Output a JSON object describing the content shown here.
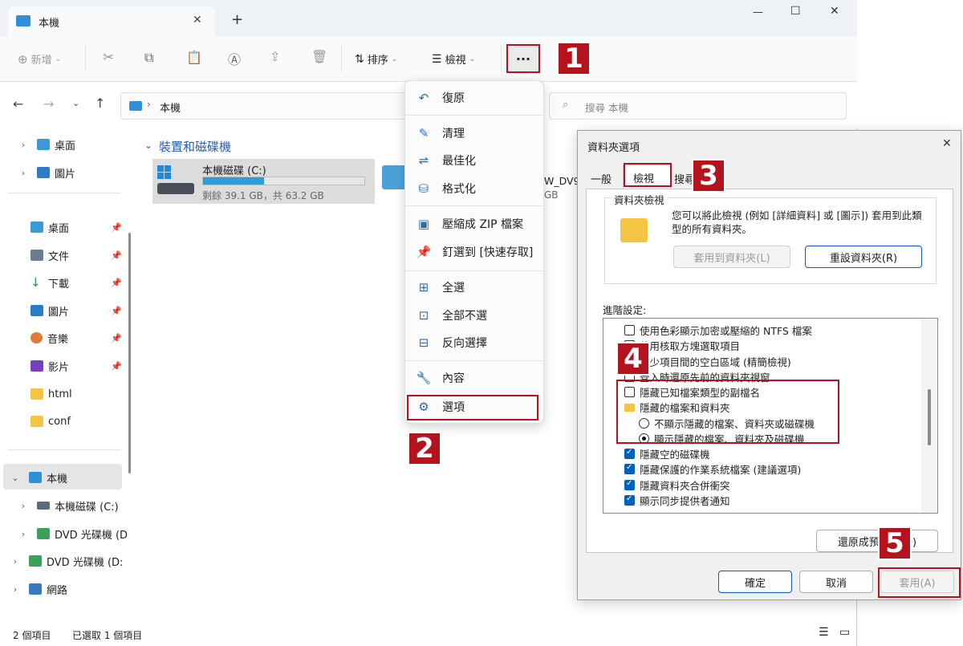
{
  "tab": {
    "title": "本機",
    "new_tab": "+"
  },
  "window_controls": {
    "minimize": "—",
    "maximize": "☐",
    "close": "✕"
  },
  "toolbar": {
    "new": "新增",
    "sort": "排序",
    "view": "檢視",
    "more": "···"
  },
  "address": {
    "location": "本機",
    "search_placeholder": "搜尋 本機"
  },
  "sidebar": {
    "top": [
      {
        "label": "桌面"
      },
      {
        "label": "圖片"
      }
    ],
    "pinned": [
      {
        "label": "桌面"
      },
      {
        "label": "文件"
      },
      {
        "label": "下載"
      },
      {
        "label": "圖片"
      },
      {
        "label": "音樂"
      },
      {
        "label": "影片"
      },
      {
        "label": "html"
      },
      {
        "label": "conf"
      }
    ],
    "this_pc": "本機",
    "this_pc_children": [
      {
        "label": "本機磁碟 (C:)"
      },
      {
        "label": "DVD 光碟機 (D"
      }
    ],
    "dvd": "DVD 光碟機 (D:",
    "network": "網路"
  },
  "content": {
    "group_title": "裝置和磁碟機",
    "drive_c": {
      "name": "本機磁碟 (C:)",
      "info": "剩餘 39.1 GB，共 63.2 GB",
      "used_fraction": 0.38
    },
    "dvd_partial_name": "W_DV9",
    "dvd_partial_info": "GB"
  },
  "status": {
    "count": "2 個項目",
    "selected": "已選取 1 個項目"
  },
  "menu": {
    "items": [
      {
        "label": "復原"
      },
      {
        "label": "清理"
      },
      {
        "label": "最佳化"
      },
      {
        "label": "格式化"
      },
      {
        "label": "壓縮成 ZIP 檔案"
      },
      {
        "label": "釘選到 [快速存取]"
      },
      {
        "label": "全選"
      },
      {
        "label": "全部不選"
      },
      {
        "label": "反向選擇"
      },
      {
        "label": "內容"
      },
      {
        "label": "選項"
      }
    ]
  },
  "dialog": {
    "title": "資料夾選項",
    "close": "✕",
    "tabs": [
      "一般",
      "檢視",
      "搜尋"
    ],
    "folder_views": {
      "group": "資料夾檢視",
      "desc": "您可以將此檢視 (例如 [詳細資料] 或 [圖示]) 套用到此類型的所有資料夾。",
      "apply_btn": "套用到資料夾(L)",
      "reset_btn": "重設資料夾(R)"
    },
    "advanced_label": "進階設定:",
    "tree": [
      {
        "label": "使用色彩顯示加密或壓縮的 NTFS 檔案",
        "kind": "check",
        "on": false
      },
      {
        "label": "使用核取方塊選取項目",
        "kind": "check",
        "on": false
      },
      {
        "label": "減少項目間的空白區域 (精簡檢視)",
        "kind": "check",
        "on": false
      },
      {
        "label": "登入時還原先前的資料夾視窗",
        "kind": "check",
        "on": false
      },
      {
        "label": "隱藏已知檔案類型的副檔名",
        "kind": "check",
        "on": false
      },
      {
        "label": "隱藏的檔案和資料夾",
        "kind": "folder",
        "on": false
      },
      {
        "label": "不顯示隱藏的檔案、資料夾或磁碟機",
        "kind": "radio",
        "on": false
      },
      {
        "label": "顯示隱藏的檔案、資料夾及磁碟機",
        "kind": "radio",
        "on": true
      },
      {
        "label": "隱藏空的磁碟機",
        "kind": "check",
        "on": true
      },
      {
        "label": "隱藏保護的作業系統檔案 (建議選項)",
        "kind": "check",
        "on": true
      },
      {
        "label": "隱藏資料夾合併衝突",
        "kind": "check",
        "on": true
      },
      {
        "label": "顯示同步提供者通知",
        "kind": "check",
        "on": true
      }
    ],
    "restore_btn": "還原成預設值(D)",
    "ok": "確定",
    "cancel": "取消",
    "apply": "套用(A)"
  },
  "badges": [
    "1",
    "2",
    "3",
    "4",
    "5"
  ],
  "colors": {
    "accent": "#0060c0",
    "badge": "#b4121c",
    "progress": "#26a0da"
  }
}
